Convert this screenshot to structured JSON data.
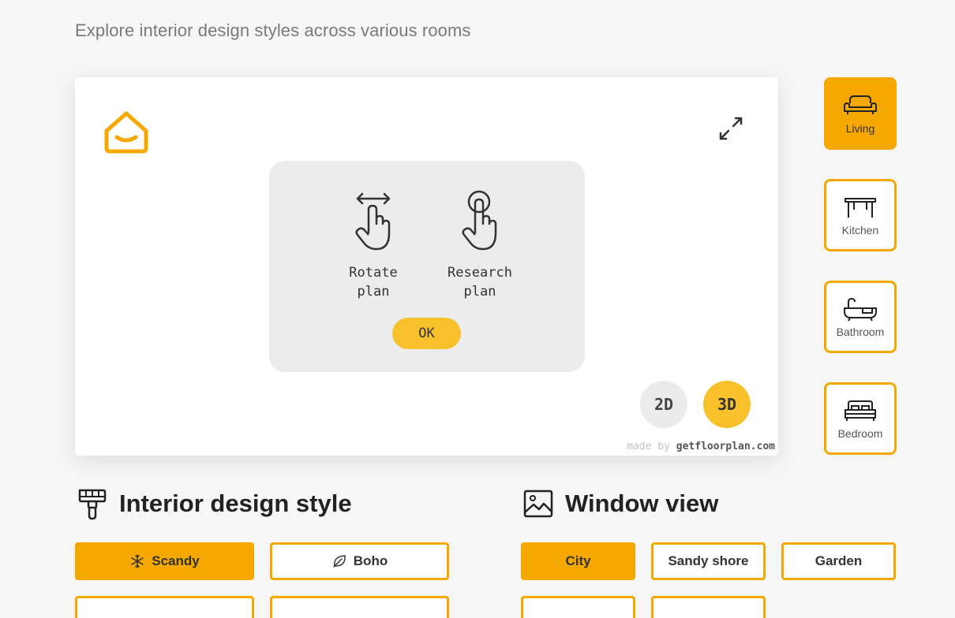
{
  "subtitle": "Explore interior design styles across various rooms",
  "viewer": {
    "hint": {
      "rotate_label": "Rotate\nplan",
      "research_label": "Research\nplan",
      "ok_label": "OK"
    },
    "mode_2d": "2D",
    "mode_3d": "3D",
    "active_mode": "3D",
    "credit_prefix": "made by",
    "credit_domain": "getfloorplan.com"
  },
  "rooms": [
    {
      "label": "Living",
      "icon": "sofa-icon",
      "active": true
    },
    {
      "label": "Kitchen",
      "icon": "table-icon",
      "active": false
    },
    {
      "label": "Bathroom",
      "icon": "bathtub-icon",
      "active": false
    },
    {
      "label": "Bedroom",
      "icon": "bed-icon",
      "active": false
    }
  ],
  "style_section": {
    "title": "Interior design style",
    "icon": "paint-roller-icon",
    "options": [
      {
        "label": "Scandy",
        "icon": "snowflake-icon",
        "active": true
      },
      {
        "label": "Boho",
        "icon": "leaf-icon",
        "active": false
      }
    ]
  },
  "window_section": {
    "title": "Window view",
    "icon": "picture-icon",
    "options": [
      {
        "label": "City",
        "active": true
      },
      {
        "label": "Sandy shore",
        "active": false
      },
      {
        "label": "Garden",
        "active": false
      }
    ]
  },
  "colors": {
    "accent": "#f5a800",
    "accent_soft": "#f8c12c",
    "background": "#f6f6f6"
  }
}
